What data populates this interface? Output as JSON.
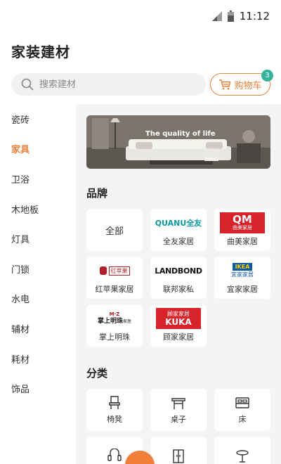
{
  "status_bar": {
    "time": "11:12"
  },
  "header": {
    "title": "家装建材"
  },
  "search": {
    "placeholder": "搜索建材"
  },
  "cart": {
    "label": "购物车",
    "badge": "3"
  },
  "sidebar": {
    "items": [
      {
        "label": "瓷砖"
      },
      {
        "label": "家具",
        "active": true
      },
      {
        "label": "卫浴"
      },
      {
        "label": "木地板"
      },
      {
        "label": "灯具"
      },
      {
        "label": "门锁"
      },
      {
        "label": "水电"
      },
      {
        "label": "辅材"
      },
      {
        "label": "耗材"
      },
      {
        "label": "饰品"
      }
    ]
  },
  "banner": {
    "title": "The quality of life"
  },
  "brands": {
    "title": "品牌",
    "items": [
      {
        "label": "全部"
      },
      {
        "label": "全友家居",
        "logo_text": "QUANU全友"
      },
      {
        "label": "曲美家居",
        "logo_text": "QM",
        "logo_sub": "曲美家居"
      },
      {
        "label": "红苹果家居",
        "logo_text": "红苹果"
      },
      {
        "label": "联邦家私",
        "logo_text": "LANDBOND"
      },
      {
        "label": "宜家家居",
        "logo_text": "IKEA",
        "logo_sub": "宜家家居"
      },
      {
        "label": "掌上明珠",
        "logo_text": "掌上明珠",
        "logo_sub": "家居"
      },
      {
        "label": "顾家家居",
        "logo_text": "顾家家居",
        "logo_sub": "KUKA"
      }
    ]
  },
  "categories": {
    "title": "分类",
    "items": [
      {
        "label": "椅凳",
        "icon": "chair-icon"
      },
      {
        "label": "桌子",
        "icon": "table-icon"
      },
      {
        "label": "床",
        "icon": "bed-icon"
      },
      {
        "label": "",
        "icon": "sofa-icon"
      },
      {
        "label": "",
        "icon": "wardrobe-icon"
      },
      {
        "label": "",
        "icon": "round-table-icon"
      }
    ]
  },
  "colors": {
    "accent": "#e8823a",
    "badge": "#35b39a",
    "main_bg": "#f4f4f4"
  }
}
